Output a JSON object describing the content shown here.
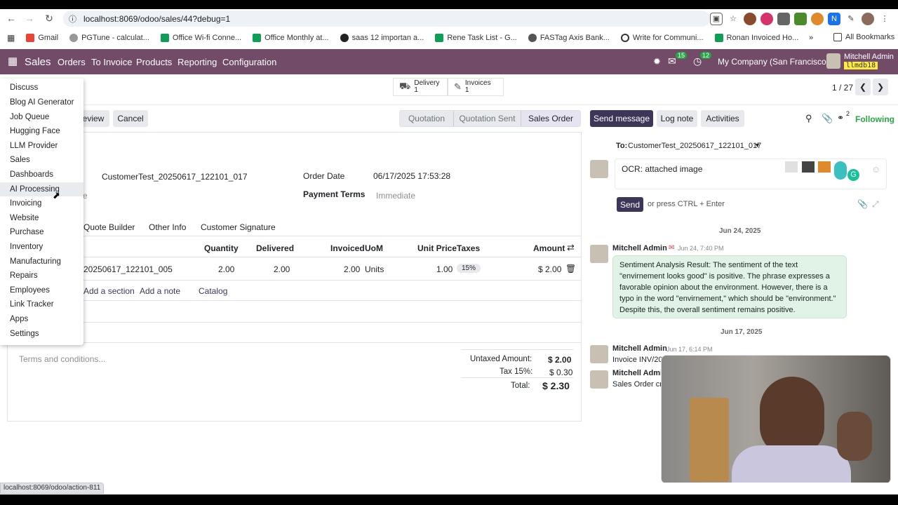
{
  "browser": {
    "url": "localhost:8069/odoo/sales/44?debug=1",
    "bookmarks": [
      "Gmail",
      "PGTune - calculat...",
      "Office Wi-fi Conne...",
      "Office Monthly at...",
      "saas 12 importan a...",
      "Rene Task List - G...",
      "FASTag Axis Bank...",
      "Write for Communi...",
      "Ronan Invoiced Ho..."
    ],
    "all_bookmarks": "All Bookmarks",
    "status_url": "localhost:8069/odoo/action-811"
  },
  "navbar": {
    "app": "Sales",
    "menus": [
      "Orders",
      "To Invoice",
      "Products",
      "Reporting",
      "Configuration"
    ],
    "messages_badge": "15",
    "activities_badge": "12",
    "company": "My Company (San Francisco)",
    "user": "Mitchell Admin",
    "db": "llmdb18"
  },
  "smart_buttons": {
    "delivery_label": "Delivery",
    "delivery_count": "1",
    "invoices_label": "Invoices",
    "invoices_count": "1"
  },
  "pager": "1 / 27",
  "actions": {
    "preview": "eview",
    "cancel": "Cancel"
  },
  "stages": [
    "Quotation",
    "Quotation Sent",
    "Sales Order"
  ],
  "chatter_buttons": {
    "send": "Send message",
    "log": "Log note",
    "activities": "Activities",
    "followers": "2",
    "following": "Following"
  },
  "form": {
    "customer": "CustomerTest_20250617_122101_017",
    "partial_label": "e",
    "order_date_label": "Order Date",
    "order_date": "06/17/2025 17:53:28",
    "payment_terms_label": "Payment Terms",
    "payment_terms_placeholder": "Immediate"
  },
  "tabs": [
    "Quote Builder",
    "Other Info",
    "Customer Signature"
  ],
  "table": {
    "headers": [
      "Quantity",
      "Delivered",
      "Invoiced",
      "UoM",
      "Unit Price",
      "Taxes",
      "Amount"
    ],
    "rows": [
      {
        "product": "20250617_122101_005",
        "qty": "2.00",
        "delivered": "2.00",
        "invoiced": "2.00",
        "uom": "Units",
        "price": "1.00",
        "tax": "15%",
        "amount": "$ 2.00"
      }
    ],
    "add_section": "Add a section",
    "add_note": "Add a note",
    "catalog": "Catalog"
  },
  "terms_placeholder": "Terms and conditions...",
  "totals": {
    "untaxed_label": "Untaxed Amount:",
    "untaxed": "$ 2.00",
    "tax_label": "Tax 15%:",
    "tax": "$ 0.30",
    "total_label": "Total:",
    "total": "$ 2.30"
  },
  "composer": {
    "to_label": "To:",
    "to": "CustomerTest_20250617_122101_017",
    "message": "OCR: attached image",
    "send": "Send",
    "hint": "or press CTRL + Enter"
  },
  "messages": [
    {
      "date": "Jun 24, 2025"
    },
    {
      "author": "Mitchell Admin",
      "time": "Jun 24, 7:40 PM",
      "body": "Sentiment Analysis Result: The sentiment of the text \"envirnement looks good\" is positive. The phrase expresses a favorable opinion about the environment. However, there is a typo in the word \"envirnement,\" which should be \"environment.\" Despite this, the overall sentiment remains positive."
    },
    {
      "date": "Jun 17, 2025"
    },
    {
      "author": "Mitchell Admin",
      "time": "Jun 17, 6:14 PM",
      "body": "Invoice INV/20"
    },
    {
      "author": "Mitchell Admi",
      "body": "Sales Order cr"
    }
  ],
  "app_menu": [
    "Discuss",
    "Blog AI Generator",
    "Job Queue",
    "Hugging Face",
    "LLM Provider",
    "Sales",
    "Dashboards",
    "AI Processing",
    "Invoicing",
    "Website",
    "Purchase",
    "Inventory",
    "Manufacturing",
    "Repairs",
    "Employees",
    "Link Tracker",
    "Apps",
    "Settings"
  ],
  "colors": {
    "brand": "#714b67",
    "primary": "#3d3659",
    "success": "#28a745"
  }
}
